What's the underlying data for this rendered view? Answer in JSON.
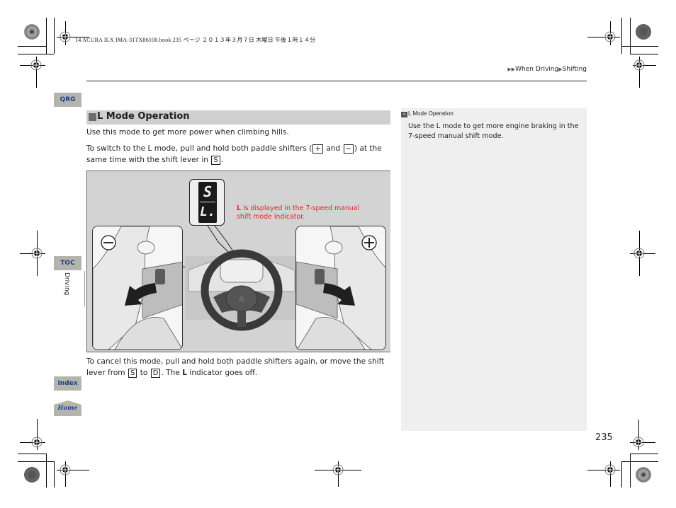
{
  "print_header": "14 ACURA ILX IMA-31TX86100.book  235 ページ  ２０１３年３月７日  木曜日  午後１時１４分",
  "breadcrumb": {
    "prefix_icon": "double-triangle-right-icon",
    "items": [
      "When Driving",
      "Shifting"
    ],
    "separator_icon": "triangle-right-icon"
  },
  "side_nav": {
    "qrg": "QRG",
    "toc": "TOC",
    "section": "Driving",
    "index": "Index",
    "home": "Home"
  },
  "section": {
    "title": "L Mode Operation",
    "paragraph1": "Use this mode to get more power when climbing hills.",
    "paragraph2": {
      "part1": "To switch to the L mode, pull and hold both paddle shifters (",
      "plus_key": "+",
      "and": " and ",
      "minus_key": "−",
      "part2": ") at the same time with the shift lever in ",
      "s_key": "S",
      "end": "."
    },
    "paragraph3": {
      "part1": "To cancel this mode, pull and hold both paddle shifters again, or move the shift lever from ",
      "s_key": "S",
      "to": " to ",
      "d_key": "D",
      "part2": ". The ",
      "l_bold": "L",
      "part3": " indicator goes off."
    }
  },
  "figure": {
    "display_top": "S",
    "display_bottom": "L.",
    "caption_bold": "L",
    "caption_rest": " is displayed in the 7-speed manual shift mode indicator.",
    "caption_line2": "shift mode indicator.",
    "left_sign": "minus",
    "right_sign": "plus",
    "accent_color": "#e0262b"
  },
  "sidebar_note": {
    "title": "L Mode Operation",
    "body": "Use the L mode to get more engine braking in the 7-speed manual shift mode."
  },
  "page_number": "235"
}
